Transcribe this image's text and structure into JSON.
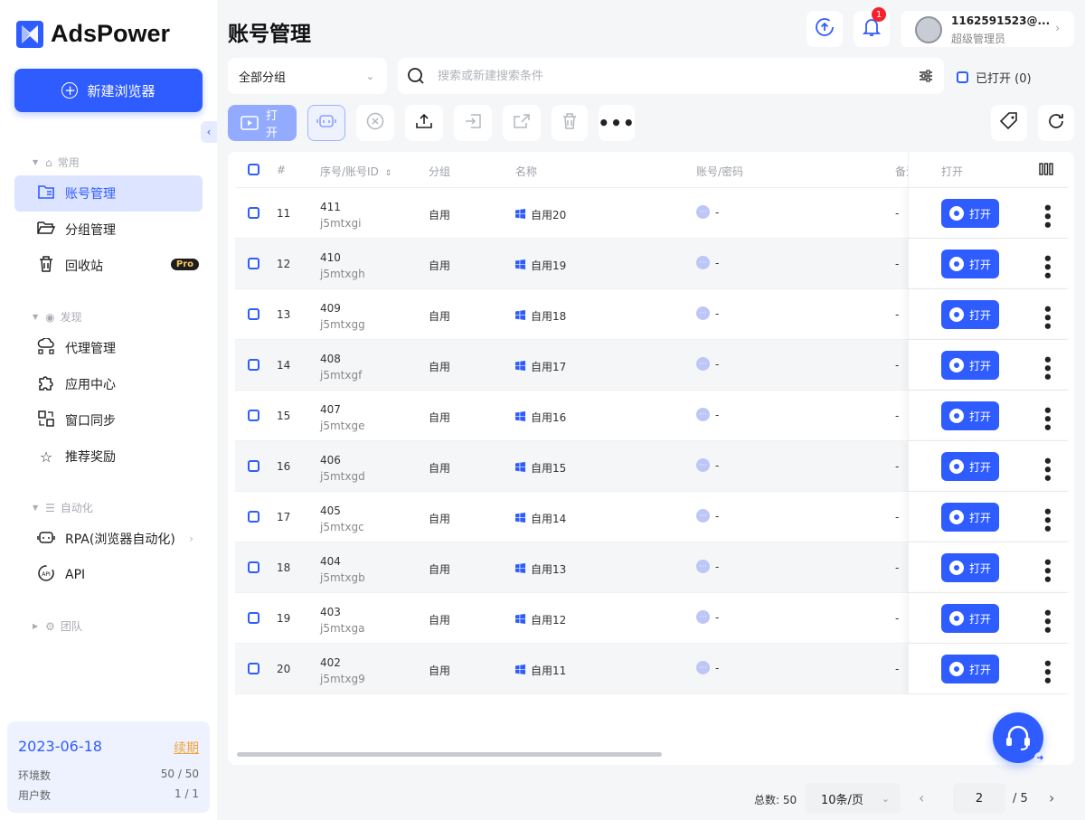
{
  "app": {
    "brand": "AdsPower",
    "accent": "#2f5cff"
  },
  "sidebar": {
    "new_button": "新建浏览器",
    "sections": {
      "common": "常用",
      "discover": "发现",
      "automation": "自动化",
      "team": "团队"
    },
    "items": {
      "accounts": "账号管理",
      "groups": "分组管理",
      "trash": "回收站",
      "trash_badge": "Pro",
      "proxy": "代理管理",
      "apps": "应用中心",
      "sync": "窗口同步",
      "rewards": "推荐奖励",
      "rpa": "RPA(浏览器自动化)",
      "api": "API"
    },
    "plan": {
      "date": "2023-06-18",
      "renew": "续期",
      "env_label": "环境数",
      "env_value": "50 / 50",
      "users_label": "用户数",
      "users_value": "1 / 1"
    }
  },
  "header": {
    "title": "账号管理",
    "notif_count": "1",
    "user_name": "1162591523@...",
    "user_role": "超级管理员"
  },
  "filters": {
    "group_select": "全部分组",
    "search_placeholder": "搜索或新建搜索条件",
    "opened_label": "已打开 (0)"
  },
  "toolbar": {
    "open_label": "打开"
  },
  "table": {
    "headers": {
      "index": "#",
      "seq": "序号/账号ID",
      "group": "分组",
      "name": "名称",
      "account": "账号/密码",
      "note": "备注",
      "open": "打开"
    },
    "open_button": "打开",
    "rows": [
      {
        "idx": "11",
        "seq": "411",
        "id": "j5mtxgi",
        "group": "自用",
        "name": "自用20",
        "account": "-",
        "note": "-"
      },
      {
        "idx": "12",
        "seq": "410",
        "id": "j5mtxgh",
        "group": "自用",
        "name": "自用19",
        "account": "-",
        "note": "-"
      },
      {
        "idx": "13",
        "seq": "409",
        "id": "j5mtxgg",
        "group": "自用",
        "name": "自用18",
        "account": "-",
        "note": "-"
      },
      {
        "idx": "14",
        "seq": "408",
        "id": "j5mtxgf",
        "group": "自用",
        "name": "自用17",
        "account": "-",
        "note": "-"
      },
      {
        "idx": "15",
        "seq": "407",
        "id": "j5mtxge",
        "group": "自用",
        "name": "自用16",
        "account": "-",
        "note": "-"
      },
      {
        "idx": "16",
        "seq": "406",
        "id": "j5mtxgd",
        "group": "自用",
        "name": "自用15",
        "account": "-",
        "note": "-"
      },
      {
        "idx": "17",
        "seq": "405",
        "id": "j5mtxgc",
        "group": "自用",
        "name": "自用14",
        "account": "-",
        "note": "-"
      },
      {
        "idx": "18",
        "seq": "404",
        "id": "j5mtxgb",
        "group": "自用",
        "name": "自用13",
        "account": "-",
        "note": "-"
      },
      {
        "idx": "19",
        "seq": "403",
        "id": "j5mtxga",
        "group": "自用",
        "name": "自用12",
        "account": "-",
        "note": "-"
      },
      {
        "idx": "20",
        "seq": "402",
        "id": "j5mtxg9",
        "group": "自用",
        "name": "自用11",
        "account": "-",
        "note": "-"
      }
    ]
  },
  "pagination": {
    "total": "总数: 50",
    "page_size": "10条/页",
    "current_page": "2",
    "total_pages": "/ 5"
  }
}
